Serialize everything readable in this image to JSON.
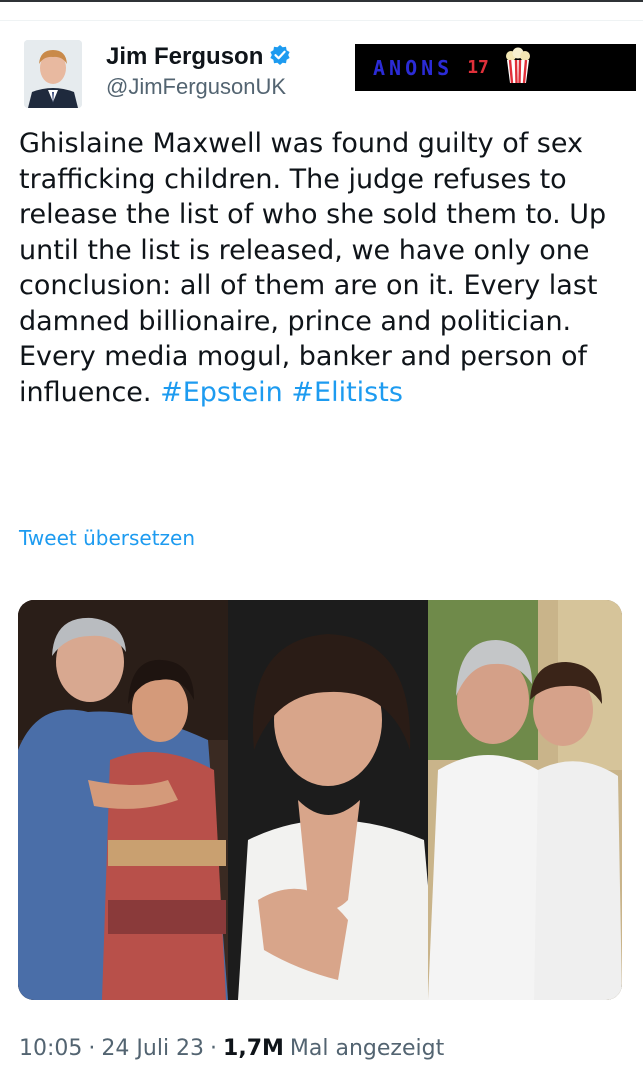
{
  "tweet": {
    "author_name": "Jim Ferguson",
    "author_handle": "@JimFergusonUK",
    "text_main": "Ghislaine Maxwell was found guilty of sex trafficking children. The judge refuses to release the list of who she sold them to. Up until the list is released, we have only one conclusion: all of them are on it. Every last damned billionaire, prince and politician. Every media mogul, banker and person of influence.",
    "hashtag_1": "#Epstein",
    "hashtag_2": "#Elitists",
    "translate_label": "Tweet übersetzen",
    "time": "10:05",
    "date": "24 Juli 23",
    "views_count": "1,7M",
    "views_label": "Mal angezeigt",
    "separator": "·"
  },
  "banner": {
    "text": "ANONS",
    "number": "17"
  },
  "colors": {
    "link": "#1d9bf0",
    "muted": "#536471",
    "text": "#0f1419",
    "verified": "#1d9bf0"
  },
  "icons": {
    "verified": "verified-badge-icon",
    "popcorn": "popcorn-icon"
  }
}
